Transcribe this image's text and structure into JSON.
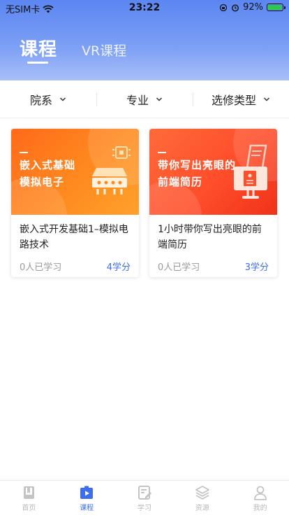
{
  "status": {
    "carrier": "无SIM卡",
    "time": "23:22",
    "battery": "92%"
  },
  "header": {
    "tab_active": "课程",
    "tab_other": "VR课程"
  },
  "filters": [
    {
      "label": "院系"
    },
    {
      "label": "专业"
    },
    {
      "label": "选修类型"
    }
  ],
  "courses": [
    {
      "cover_line1": "嵌入式基础",
      "cover_line2": "模拟电子",
      "title": "嵌入式开发基础1–模拟电路技术",
      "learners": "0人已学习",
      "credit": "4学分",
      "cover_color": "#ff8a1f"
    },
    {
      "cover_line1": "带你写出亮眼的",
      "cover_line2": "前端简历",
      "title": "1小时带你写出亮眼的前端简历",
      "learners": "0人已学习",
      "credit": "3学分",
      "cover_color": "#ff4e2a"
    }
  ],
  "tabbar": [
    {
      "label": "首页",
      "icon": "book-icon"
    },
    {
      "label": "课程",
      "icon": "play-course-icon"
    },
    {
      "label": "学习",
      "icon": "edit-note-icon"
    },
    {
      "label": "资源",
      "icon": "layers-icon"
    },
    {
      "label": "我的",
      "icon": "person-icon"
    }
  ],
  "colors": {
    "accent": "#3e6ef0",
    "header_top": "#5b86f2"
  }
}
